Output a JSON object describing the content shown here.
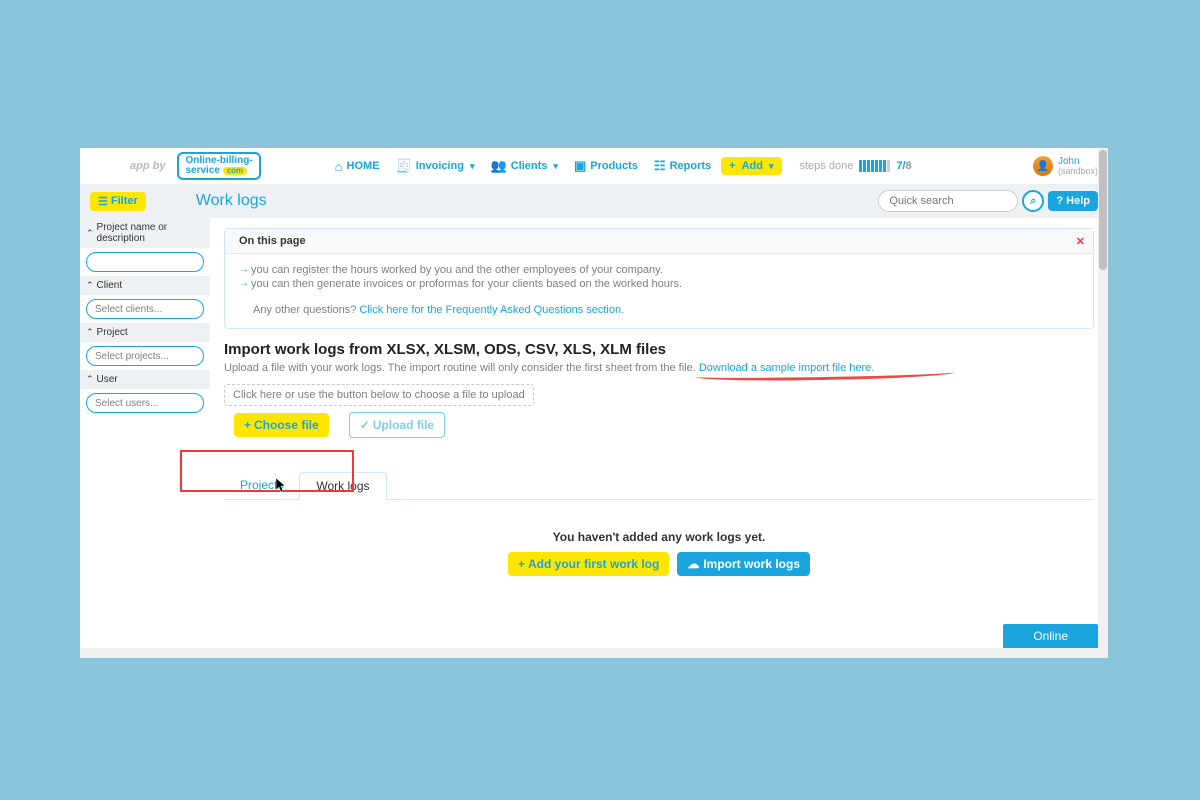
{
  "brand": {
    "app_by": "app by",
    "line1": "Online-billing-",
    "line2": "service",
    "pill": "com"
  },
  "nav": {
    "home": "HOME",
    "invoicing": "Invoicing",
    "clients": "Clients",
    "products": "Products",
    "reports": "Reports",
    "add": "Add"
  },
  "steps": {
    "label": "steps done",
    "done": "7",
    "total": "8"
  },
  "user": {
    "name": "John",
    "mode": "(sandbox)"
  },
  "subbar": {
    "filter": "Filter",
    "title": "Work logs",
    "help": "Help"
  },
  "search": {
    "placeholder": "Quick search"
  },
  "sidebar": {
    "sections": {
      "project_desc": {
        "label": "Project name or description"
      },
      "client": {
        "label": "Client",
        "placeholder": "Select clients..."
      },
      "project": {
        "label": "Project",
        "placeholder": "Select projects..."
      },
      "user": {
        "label": "User",
        "placeholder": "Select users..."
      }
    }
  },
  "panel": {
    "header": "On this page",
    "line1": "you can register the hours worked by you and the other employees of your company.",
    "line2": "you can then generate invoices or proformas for your clients based on the worked hours.",
    "faq_prefix": "Any other questions? ",
    "faq_link": "Click here for the Frequently Asked Questions section"
  },
  "import": {
    "title": "Import work logs from XLSX, XLSM, ODS, CSV, XLS, XLM files",
    "desc": "Upload a file with your work logs. The import routine will only consider the first sheet from the file. ",
    "sample_link": "Download a sample import file here",
    "drop_hint": "Click here or use the button below to choose a file to upload",
    "choose": "Choose file",
    "upload": "Upload file"
  },
  "tabs": {
    "projects": "Projects",
    "worklogs": "Work logs"
  },
  "empty": {
    "msg": "You haven't added any work logs yet.",
    "add": "Add your first work log",
    "import": "Import work logs"
  },
  "online": "Online"
}
